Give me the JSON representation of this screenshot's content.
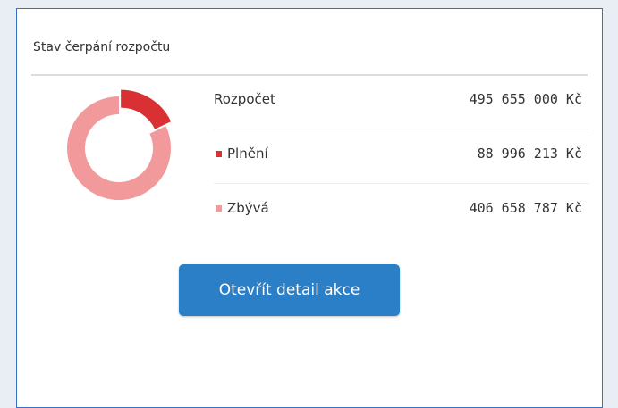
{
  "panel": {
    "title": "Stav čerpání rozpočtu"
  },
  "budget": {
    "rows": [
      {
        "label": "Rozpočet",
        "value": "495 655 000 Kč"
      },
      {
        "label": "Plnění",
        "value": "88 996 213 Kč",
        "marker_color": "#d83033"
      },
      {
        "label": "Zbývá",
        "value": "406 658 787 Kč",
        "marker_color": "#f29a9b"
      }
    ]
  },
  "chart_data": {
    "type": "pie",
    "categories": [
      "Plnění",
      "Zbývá"
    ],
    "values": [
      88996213,
      406658787
    ],
    "colors": [
      "#d83033",
      "#f29a9b"
    ]
  },
  "actions": {
    "open_detail_label": "Otevřít detail akce"
  }
}
